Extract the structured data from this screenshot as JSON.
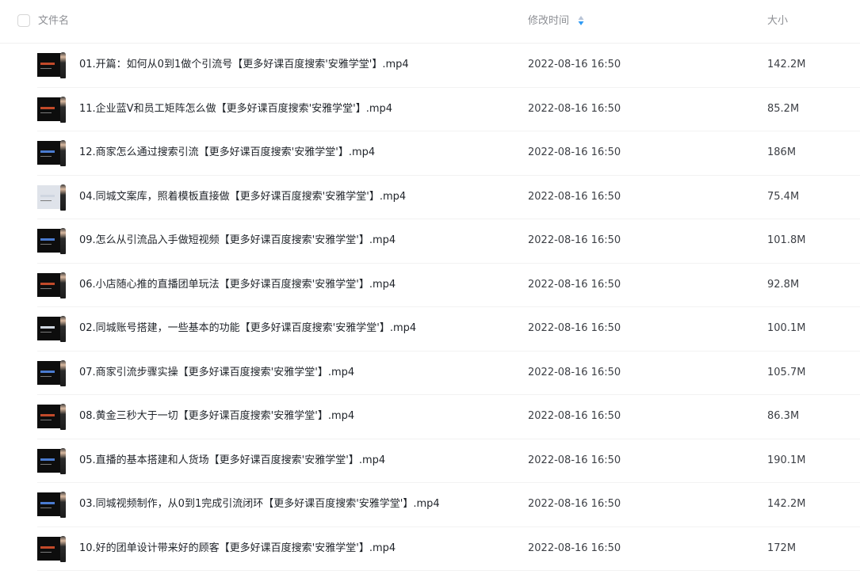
{
  "header": {
    "name_label": "文件名",
    "time_label": "修改时间",
    "size_label": "大小"
  },
  "sort_icon_colors": {
    "up": "#b8c4d6",
    "down": "#2f9bf4"
  },
  "files": [
    {
      "name": "01.开篇：如何从0到1做个引流号【更多好课百度搜索'安雅学堂'】.mp4",
      "time": "2022-08-16 16:50",
      "size": "142.2M",
      "thumb": "dark-red"
    },
    {
      "name": "11.企业蓝V和员工矩阵怎么做【更多好课百度搜索'安雅学堂'】.mp4",
      "time": "2022-08-16 16:50",
      "size": "85.2M",
      "thumb": "dark-red"
    },
    {
      "name": "12.商家怎么通过搜索引流【更多好课百度搜索'安雅学堂'】.mp4",
      "time": "2022-08-16 16:50",
      "size": "186M",
      "thumb": "dark-blue"
    },
    {
      "name": "04.同城文案库，照着模板直接做【更多好课百度搜索'安雅学堂'】.mp4",
      "time": "2022-08-16 16:50",
      "size": "75.4M",
      "thumb": "light"
    },
    {
      "name": "09.怎么从引流品入手做短视频【更多好课百度搜索'安雅学堂'】.mp4",
      "time": "2022-08-16 16:50",
      "size": "101.8M",
      "thumb": "dark-blue"
    },
    {
      "name": "06.小店随心推的直播团单玩法【更多好课百度搜索'安雅学堂'】.mp4",
      "time": "2022-08-16 16:50",
      "size": "92.8M",
      "thumb": "dark-red"
    },
    {
      "name": "02.同城账号搭建，一些基本的功能【更多好课百度搜索'安雅学堂'】.mp4",
      "time": "2022-08-16 16:50",
      "size": "100.1M",
      "thumb": "dark-white"
    },
    {
      "name": "07.商家引流步骤实操【更多好课百度搜索'安雅学堂'】.mp4",
      "time": "2022-08-16 16:50",
      "size": "105.7M",
      "thumb": "dark-blue"
    },
    {
      "name": "08.黄金三秒大于一切【更多好课百度搜索'安雅学堂'】.mp4",
      "time": "2022-08-16 16:50",
      "size": "86.3M",
      "thumb": "dark-red"
    },
    {
      "name": "05.直播的基本搭建和人货场【更多好课百度搜索'安雅学堂'】.mp4",
      "time": "2022-08-16 16:50",
      "size": "190.1M",
      "thumb": "dark-blue"
    },
    {
      "name": "03.同城视频制作，从0到1完成引流闭环【更多好课百度搜索'安雅学堂'】.mp4",
      "time": "2022-08-16 16:50",
      "size": "142.2M",
      "thumb": "dark-blue"
    },
    {
      "name": "10.好的团单设计带来好的顾客【更多好课百度搜索'安雅学堂'】.mp4",
      "time": "2022-08-16 16:50",
      "size": "172M",
      "thumb": "dark-red"
    }
  ]
}
